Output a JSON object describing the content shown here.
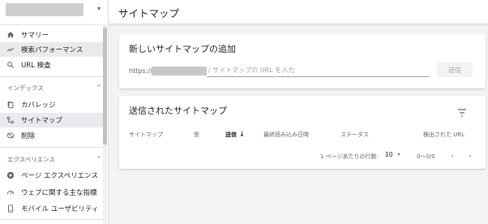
{
  "header": {
    "title": "サイトマップ"
  },
  "sidebar": {
    "property_caret": "▾",
    "items": [
      {
        "label": "サマリー",
        "icon": "home-icon"
      },
      {
        "label": "検索パフォーマンス",
        "icon": "trending-up-icon"
      },
      {
        "label": "URL 検査",
        "icon": "search-icon"
      }
    ],
    "section_index": {
      "label": "インデックス",
      "chevron": "^"
    },
    "index_items": [
      {
        "label": "カバレッジ",
        "icon": "copy-icon"
      },
      {
        "label": "サイトマップ",
        "icon": "sitemap-icon"
      },
      {
        "label": "削除",
        "icon": "eye-off-icon"
      }
    ],
    "section_experience": {
      "label": "エクスペリエンス",
      "chevron": "^"
    },
    "experience_items": [
      {
        "label": "ページ エクスペリエンス",
        "icon": "plus-circle-icon"
      },
      {
        "label": "ウェブに関する主な指標",
        "icon": "speedometer-icon"
      },
      {
        "label": "モバイル ユーザビリティ",
        "icon": "phone-icon"
      }
    ]
  },
  "add_card": {
    "title": "新しいサイトマップの追加",
    "url_prefix": "https://",
    "url_placeholder": "/ サイトマップの URL を入力",
    "submit_label": "送信"
  },
  "submitted_card": {
    "title": "送信されたサイトマップ",
    "columns": [
      "サイトマップ",
      "型",
      "送信",
      "最終読み込み日時",
      "ステータス",
      "検出された URL"
    ],
    "sort_arrow": "↓",
    "rows_per_page_label": "1 ページあたりの行数:",
    "rows_per_page_value": "10",
    "rows_dropdown": "▾",
    "range": "0〜0/0",
    "prev": "‹",
    "next": "›"
  },
  "colors": {
    "active_bg": "#e8eaed",
    "text": "#202124",
    "muted": "#5f6368",
    "border": "#e0e0e0"
  }
}
